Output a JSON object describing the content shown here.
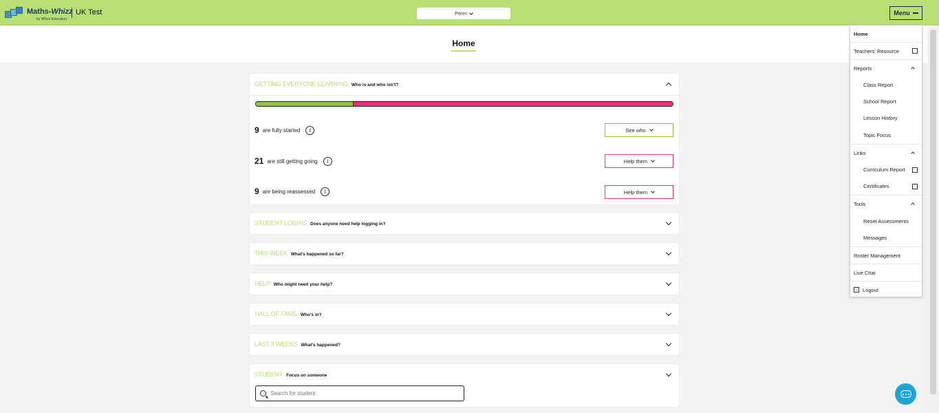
{
  "header": {
    "logo_text": "Maths-",
    "logo_text_whizz": "Whizz",
    "logo_subtext": "by Whizz Education",
    "school_name": "UK Test",
    "class_select": "Perm",
    "menu_label": "Menu",
    "accent_color": "#b9df73"
  },
  "page": {
    "title": "Home"
  },
  "getting_learning": {
    "title": "Getting Everyone Learning",
    "subtitle": "Who is and who isn't?",
    "progress": {
      "fully_started_fraction": 0.235,
      "green_color": "#8cc63f",
      "pink_color": "#e8317a"
    },
    "rows": [
      {
        "count": "9",
        "text": "are fully started",
        "button": "See who"
      },
      {
        "count": "21",
        "text": "are still getting going",
        "button": "Help them"
      },
      {
        "count": "9",
        "text": "are being reassessed",
        "button": "Help them"
      }
    ]
  },
  "sections": [
    {
      "title": "Student Logins",
      "subtitle": "Does anyone need help logging in?"
    },
    {
      "title": "This Week",
      "subtitle": "What's happened so far?"
    },
    {
      "title": "Help",
      "subtitle": "Who might need your help?"
    },
    {
      "title": "Hall of Fame",
      "subtitle": "Who's in?"
    },
    {
      "title": "Last 8 Weeks",
      "subtitle": "What's happened?"
    },
    {
      "title": "Student",
      "subtitle": "Focus on someone"
    }
  ],
  "search": {
    "placeholder": "Search for student"
  },
  "menu": {
    "home": "Home",
    "teachers_resource": "Teachers' Resource",
    "reports": "Reports",
    "class_report": "Class Report",
    "school_report": "School Report",
    "lesson_history": "Lesson History",
    "topic_focus": "Topic Focus",
    "links": "Links",
    "curriculum_report": "Curriculum Report",
    "certificates": "Certificates",
    "tools": "Tools",
    "reset_assessments": "Reset Assessments",
    "messages": "Messages",
    "roster_management": "Roster Management",
    "live_chat": "Live Chat",
    "logout": "Logout"
  }
}
